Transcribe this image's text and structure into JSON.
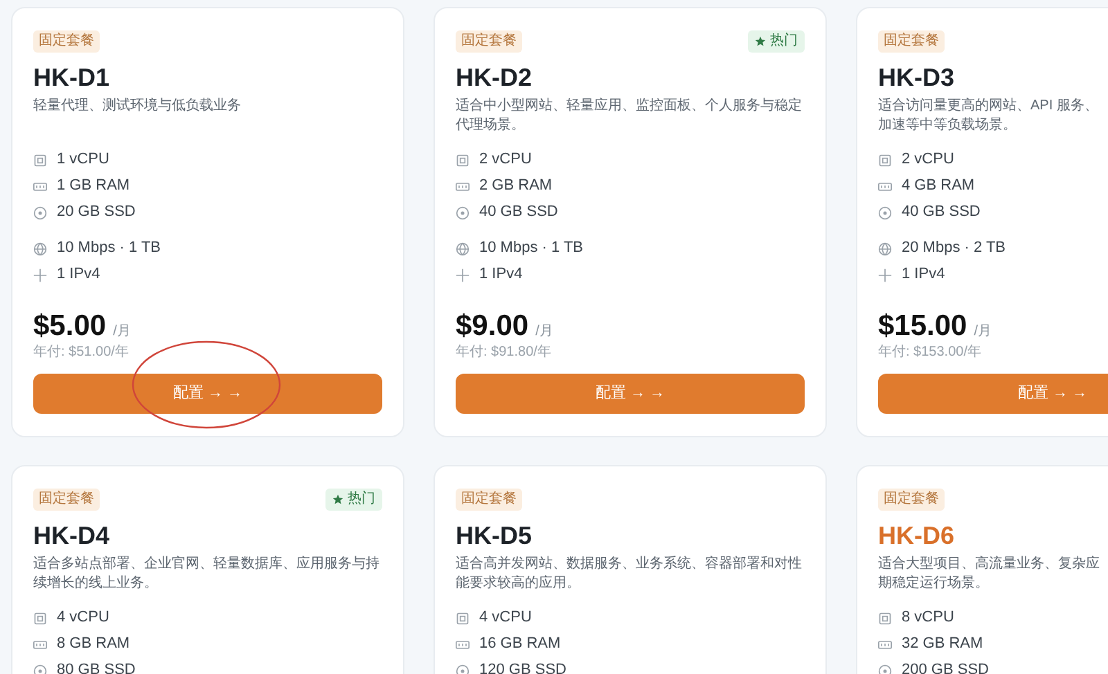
{
  "plans": [
    {
      "tag": "固定套餐",
      "hot": false,
      "highlighted": false,
      "circled": true,
      "name": "HK-D1",
      "description_lines": [
        "轻量代理、测试环境与低负载业务"
      ],
      "hardware": [
        {
          "kind": "cpu",
          "text": "1 vCPU"
        },
        {
          "kind": "ram",
          "text": "1 GB RAM"
        },
        {
          "kind": "disk",
          "text": "20 GB SSD"
        }
      ],
      "network": [
        {
          "kind": "bandwidth",
          "text": "10 Mbps · 1 TB"
        },
        {
          "kind": "ip",
          "text": "1 IPv4"
        }
      ],
      "price": "$5.00",
      "period": "/月",
      "annual": "年付: $51.00/年",
      "button": "配置 → →"
    },
    {
      "tag": "固定套餐",
      "hot": true,
      "hot_label": "热门",
      "highlighted": false,
      "circled": false,
      "name": "HK-D2",
      "description_lines": [
        "适合中小型网站、轻量应用、监控面板、个人服务与稳定",
        "代理场景。"
      ],
      "hardware": [
        {
          "kind": "cpu",
          "text": "2 vCPU"
        },
        {
          "kind": "ram",
          "text": "2 GB RAM"
        },
        {
          "kind": "disk",
          "text": "40 GB SSD"
        }
      ],
      "network": [
        {
          "kind": "bandwidth",
          "text": "10 Mbps · 1 TB"
        },
        {
          "kind": "ip",
          "text": "1 IPv4"
        }
      ],
      "price": "$9.00",
      "period": "/月",
      "annual": "年付: $91.80/年",
      "button": "配置 → →"
    },
    {
      "tag": "固定套餐",
      "hot": false,
      "highlighted": false,
      "circled": false,
      "name": "HK-D3",
      "description_lines": [
        "适合访问量更高的网站、API 服务、",
        "加速等中等负载场景。"
      ],
      "hardware": [
        {
          "kind": "cpu",
          "text": "2 vCPU"
        },
        {
          "kind": "ram",
          "text": "4 GB RAM"
        },
        {
          "kind": "disk",
          "text": "40 GB SSD"
        }
      ],
      "network": [
        {
          "kind": "bandwidth",
          "text": "20 Mbps · 2 TB"
        },
        {
          "kind": "ip",
          "text": "1 IPv4"
        }
      ],
      "price": "$15.00",
      "period": "/月",
      "annual": "年付: $153.00/年",
      "button": "配置 → →"
    },
    {
      "tag": "固定套餐",
      "hot": true,
      "hot_label": "热门",
      "highlighted": false,
      "circled": false,
      "name": "HK-D4",
      "description_lines": [
        "适合多站点部署、企业官网、轻量数据库、应用服务与持",
        "续增长的线上业务。"
      ],
      "hardware": [
        {
          "kind": "cpu",
          "text": "4 vCPU"
        },
        {
          "kind": "ram",
          "text": "8 GB RAM"
        },
        {
          "kind": "disk",
          "text": "80 GB SSD"
        }
      ]
    },
    {
      "tag": "固定套餐",
      "hot": false,
      "highlighted": false,
      "circled": false,
      "name": "HK-D5",
      "description_lines": [
        "适合高并发网站、数据服务、业务系统、容器部署和对性",
        "能要求较高的应用。"
      ],
      "hardware": [
        {
          "kind": "cpu",
          "text": "4 vCPU"
        },
        {
          "kind": "ram",
          "text": "16 GB RAM"
        },
        {
          "kind": "disk",
          "text": "120 GB SSD"
        }
      ]
    },
    {
      "tag": "固定套餐",
      "hot": false,
      "highlighted": true,
      "circled": false,
      "name": "HK-D6",
      "description_lines": [
        "适合大型项目、高流量业务、复杂应",
        "期稳定运行场景。"
      ],
      "hardware": [
        {
          "kind": "cpu",
          "text": "8 vCPU"
        },
        {
          "kind": "ram",
          "text": "32 GB RAM"
        },
        {
          "kind": "disk",
          "text": "200 GB SSD"
        }
      ]
    }
  ]
}
